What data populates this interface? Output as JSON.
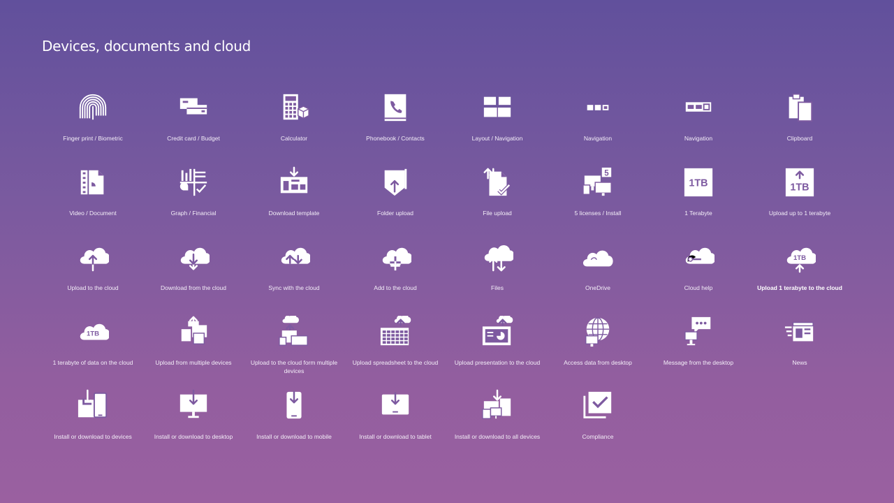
{
  "slide": {
    "title": "Devices, documents and cloud",
    "icon_color": "#ffffff",
    "background_colors": [
      "#61509C",
      "#9A60A0"
    ]
  },
  "icons": [
    [
      {
        "label": "Finger print / Biometric",
        "icon": "fingerprint-icon"
      },
      {
        "label": "Credit card / Budget",
        "icon": "credit-card-icon"
      },
      {
        "label": "Calculator",
        "icon": "calculator-icon"
      },
      {
        "label": "Phonebook / Contacts",
        "icon": "phonebook-icon"
      },
      {
        "label": "Layout / Navigation",
        "icon": "layout-icon"
      },
      {
        "label": "Navigation",
        "icon": "navigation-dots-icon"
      },
      {
        "label": "Navigation",
        "icon": "navigation-bar-icon"
      },
      {
        "label": "Clipboard",
        "icon": "clipboard-icon"
      }
    ],
    [
      {
        "label": "Video / Document",
        "icon": "video-document-icon"
      },
      {
        "label": "Graph / Financial",
        "icon": "graph-financial-icon"
      },
      {
        "label": "Download template",
        "icon": "download-template-icon"
      },
      {
        "label": "Folder upload",
        "icon": "folder-upload-icon"
      },
      {
        "label": "File upload",
        "icon": "file-upload-icon"
      },
      {
        "label": "5 licenses / Install",
        "icon": "licenses-install-icon",
        "badge": "5"
      },
      {
        "label": "1 Terabyte",
        "icon": "terabyte-icon",
        "badge": "1TB"
      },
      {
        "label": "Upload up to 1 terabyte",
        "icon": "upload-terabyte-icon",
        "badge": "1TB"
      }
    ],
    [
      {
        "label": "Upload to the cloud",
        "icon": "cloud-upload-icon"
      },
      {
        "label": "Download from the cloud",
        "icon": "cloud-download-icon"
      },
      {
        "label": "Sync with the cloud",
        "icon": "cloud-sync-icon"
      },
      {
        "label": "Add to the cloud",
        "icon": "cloud-add-icon"
      },
      {
        "label": "Files",
        "icon": "cloud-files-icon"
      },
      {
        "label": "OneDrive",
        "icon": "onedrive-icon"
      },
      {
        "label": "Cloud help",
        "icon": "cloud-help-icon"
      },
      {
        "label": "Upload 1 terabyte to the cloud",
        "icon": "cloud-upload-terabyte-icon",
        "badge": "1TB",
        "bold": true
      }
    ],
    [
      {
        "label": "1 terabyte of data on the cloud",
        "icon": "cloud-terabyte-icon",
        "badge": "1TB"
      },
      {
        "label": "Upload from multiple devices",
        "icon": "upload-multiple-devices-icon"
      },
      {
        "label": "Upload to the cloud form multiple devices",
        "icon": "cloud-multiple-devices-icon"
      },
      {
        "label": "Upload spreadsheet to the cloud",
        "icon": "upload-spreadsheet-icon"
      },
      {
        "label": "Upload presentation to the cloud",
        "icon": "upload-presentation-icon"
      },
      {
        "label": "Access data from desktop",
        "icon": "globe-desktop-icon"
      },
      {
        "label": "Message from the desktop",
        "icon": "desktop-message-icon"
      },
      {
        "label": "News",
        "icon": "news-icon"
      }
    ],
    [
      {
        "label": "Install or download to devices",
        "icon": "install-devices-icon"
      },
      {
        "label": "Install or download to desktop",
        "icon": "install-desktop-icon"
      },
      {
        "label": "Install or download to mobile",
        "icon": "install-mobile-icon"
      },
      {
        "label": "Install or download to tablet",
        "icon": "install-tablet-icon"
      },
      {
        "label": "Install or download to all devices",
        "icon": "install-all-devices-icon"
      },
      {
        "label": "Compliance",
        "icon": "compliance-icon"
      }
    ]
  ]
}
